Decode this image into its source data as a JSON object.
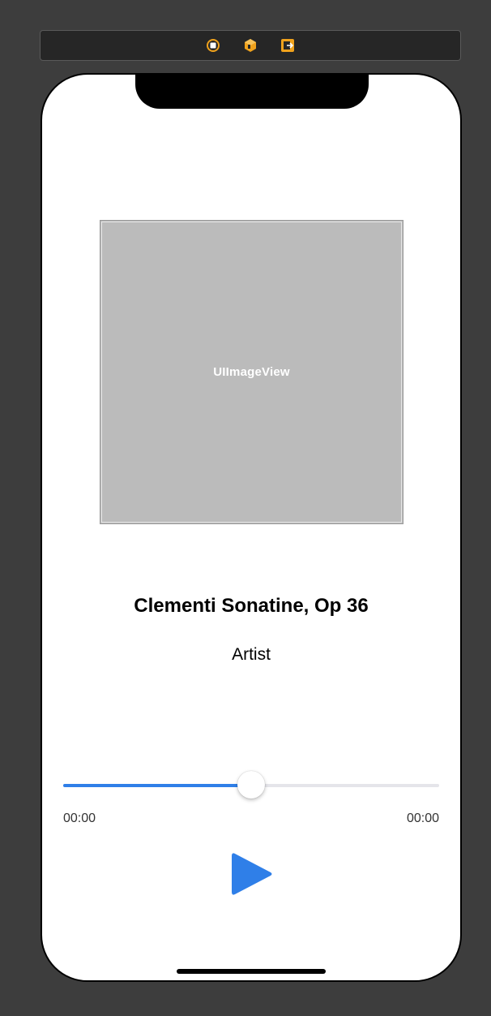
{
  "scene_dock": {
    "icons": [
      "view-controller-icon",
      "first-responder-icon",
      "exit-icon"
    ],
    "accent_color": "#f0a21c"
  },
  "player": {
    "image_view_label": "UIImageView",
    "title": "Clementi Sonatine, Op 36",
    "artist": "Artist",
    "progress_fraction": 0.5,
    "elapsed_time": "00:00",
    "remaining_time": "00:00",
    "play_icon": "play-icon",
    "tint_color": "#2f7fe8"
  }
}
